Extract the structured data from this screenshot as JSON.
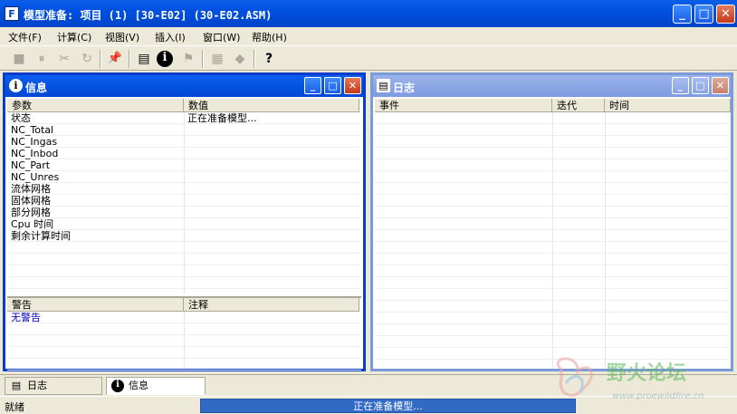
{
  "window": {
    "title": "模型准备: 项目 (1) [30-E02] (30-E02.ASM)",
    "app_icon_letter": "F",
    "min_label": "_",
    "max_label": "□",
    "close_label": "✕"
  },
  "menu": [
    "文件(F)",
    "计算(C)",
    "视图(V)",
    "插入(I)",
    "窗口(W)",
    "帮助(H)"
  ],
  "toolbar": {
    "stop": "■",
    "pause": "⏸",
    "tool": "✂",
    "refresh": "↻",
    "pin": "📌",
    "log": "▤",
    "info": "i",
    "flag": "⚑",
    "grid": "▦",
    "diamond": "◆",
    "help": "?"
  },
  "info_window": {
    "title": "信息",
    "columns": [
      "参数",
      "数值"
    ],
    "rows": [
      [
        "状态",
        "正在准备模型..."
      ],
      [
        "NC_Total",
        ""
      ],
      [
        "NC_Ingas",
        ""
      ],
      [
        "NC_Inbod",
        ""
      ],
      [
        "NC_Part",
        ""
      ],
      [
        "NC_Unres",
        ""
      ],
      [
        "流体网格",
        ""
      ],
      [
        "固体网格",
        ""
      ],
      [
        "部分网格",
        ""
      ],
      [
        "Cpu 时间",
        ""
      ],
      [
        "剩余计算时间",
        ""
      ]
    ],
    "warn_columns": [
      "警告",
      "注释"
    ],
    "warn_rows": [
      [
        "无警告",
        ""
      ]
    ]
  },
  "log_window": {
    "title": "日志",
    "columns": [
      "事件",
      "迭代",
      "时间"
    ]
  },
  "tabs": [
    {
      "label": "日志",
      "icon": "document-icon"
    },
    {
      "label": "信息",
      "icon": "info-icon"
    }
  ],
  "status": {
    "text": "就绪",
    "progress_text": "正在准备模型...",
    "progress_fraction": 1.0
  },
  "watermark": {
    "text": "野火论坛",
    "url": "www.proewildfire.cn"
  }
}
